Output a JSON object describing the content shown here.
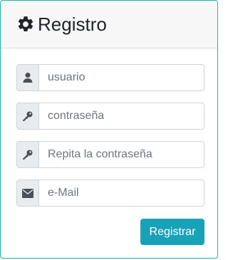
{
  "header": {
    "title": "Registro",
    "icon": "gear-icon"
  },
  "form": {
    "username": {
      "placeholder": "usuario",
      "value": "",
      "icon": "user-icon"
    },
    "password": {
      "placeholder": "contraseña",
      "value": "",
      "icon": "key-icon"
    },
    "password_repeat": {
      "placeholder": "Repita la contraseña",
      "value": "",
      "icon": "key-icon"
    },
    "email": {
      "placeholder": "e-Mail",
      "value": "",
      "icon": "envelope-icon"
    },
    "submit_label": "Registrar"
  },
  "colors": {
    "accent": "#17a2b8",
    "card_border": "#1fb5a1",
    "header_bg": "#f7f7f7",
    "addon_bg": "#e9ecef"
  }
}
